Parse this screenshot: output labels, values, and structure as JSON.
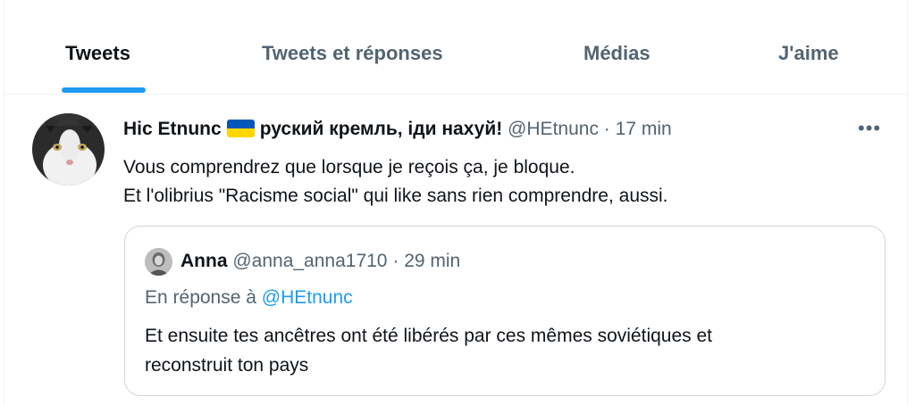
{
  "tabs": [
    {
      "label": "Tweets",
      "active": true
    },
    {
      "label": "Tweets et réponses",
      "active": false
    },
    {
      "label": "Médias",
      "active": false
    },
    {
      "label": "J'aime",
      "active": false
    }
  ],
  "tweet": {
    "name": "Hic Etnunc",
    "flag_icon": "ukraine-flag-icon",
    "name_suffix": "руский кремль, іди нахуй!",
    "handle": "@HEtnunc",
    "separator": "·",
    "time": "17 min",
    "more_label": "•••",
    "text_lines": [
      "Vous comprendrez que lorsque je reçois ça, je bloque.",
      "Et l'olibrius \"Racisme social\" qui like sans rien comprendre, aussi."
    ]
  },
  "quote": {
    "name": "Anna",
    "handle": "@anna_anna1710",
    "separator": "·",
    "time": "29 min",
    "reply_prefix": "En réponse à",
    "reply_mention": "@HEtnunc",
    "text_lines": [
      "Et ensuite tes ancêtres ont été libérés par ces mêmes soviétiques et",
      "reconstruit ton pays"
    ]
  },
  "colors": {
    "accent": "#1d9bf0",
    "secondary_text": "#536471",
    "primary_text": "#0f1419",
    "border": "#cfd9de"
  }
}
